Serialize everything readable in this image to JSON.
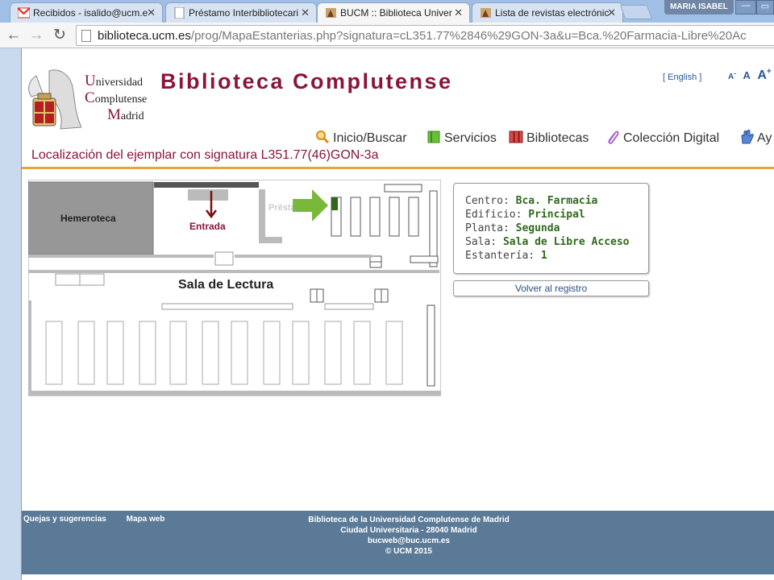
{
  "browser": {
    "tabs": [
      {
        "title": "Recibidos - isalido@ucm.e",
        "icon": "gmail-icon"
      },
      {
        "title": "Préstamo Interbibliotecari",
        "icon": "page-icon"
      },
      {
        "title": "BUCM :: Biblioteca Univer",
        "icon": "bucm-icon"
      },
      {
        "title": "Lista de revistas electrónic",
        "icon": "bucm-icon"
      }
    ],
    "user": "MARIA ISABEL",
    "url_host": "biblioteca.ucm.es",
    "url_path": "/prog/MapaEstanterias.php?signatura=cL351.77%2846%29GON-3a&u=Bca.%20Farmacia-Libre%20Ac"
  },
  "header": {
    "ucm_lines": [
      {
        "cap": "U",
        "rest": "niversidad"
      },
      {
        "cap": "C",
        "rest": "omplutense"
      },
      {
        "cap": "M",
        "rest": "adrid"
      }
    ],
    "site_title": "Biblioteca Complutense",
    "lang_link": "[ English ]",
    "font_small": "A",
    "font_medium": "A",
    "font_large": "A",
    "font_minus": "-",
    "font_plus": "+"
  },
  "nav": [
    {
      "label": "Inicio/Buscar",
      "icon": "search-icon"
    },
    {
      "label": "Servicios",
      "icon": "book-icon"
    },
    {
      "label": "Bibliotecas",
      "icon": "library-icon"
    },
    {
      "label": "Colección Digital",
      "icon": "clip-icon"
    },
    {
      "label": "Ay",
      "icon": "hand-icon"
    }
  ],
  "location_title": "Localización del ejemplar con signatura L351.77(46)GON-3a",
  "map": {
    "hemeroteca": "Hemeroteca",
    "entrada": "Entrada",
    "prestamo": "Préstamo",
    "sala_lectura": "Sala de Lectura"
  },
  "info": {
    "centro_label": "Centro:",
    "centro": "Bca. Farmacia",
    "edificio_label": "Edificio:",
    "edificio": "Principal",
    "planta_label": "Planta:",
    "planta": "Segunda",
    "sala_label": "Sala:",
    "sala": "Sala de Libre Acceso",
    "estanteria_label": "Estantería:",
    "estanteria": "1"
  },
  "back_button": "Volver al registro",
  "footer": {
    "link_quejas": "Quejas y sugerencias",
    "link_mapa": "Mapa web",
    "lines": [
      "Biblioteca de la Universidad Complutense de Madrid",
      "Ciudad Universitaria - 28040 Madrid",
      "bucweb@buc.ucm.es",
      "© UCM 2015"
    ]
  },
  "colors": {
    "brand": "#8a1538",
    "accent_rule": "#e8a33a",
    "value_green": "#2f6a1c",
    "footer_bg": "#5a7a97"
  }
}
